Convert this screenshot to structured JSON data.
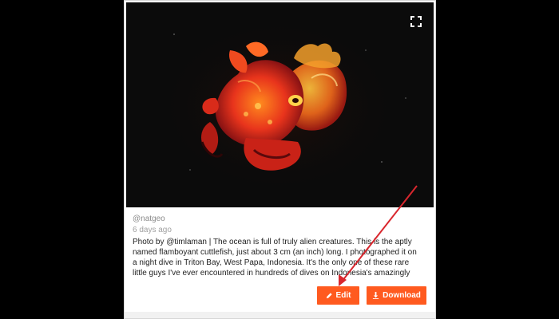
{
  "post": {
    "handle": "@natgeo",
    "age": "6 days ago",
    "caption": "Photo by @timlaman | The ocean is full of truly alien creatures. This is the aptly named flamboyant cuttlefish, just about 3 cm (an inch) long. I photographed it on a night dive in Triton Bay, West Papa, Indonesia. It's the only one of these rare little guys I've ever encountered in hundreds of dives on Indonesia's amazingly diverse coral reefs."
  },
  "actions": {
    "edit_label": "Edit",
    "download_label": "Download"
  },
  "icons": {
    "expand": "expand-icon",
    "edit": "pencil-icon",
    "download": "download-icon"
  },
  "colors": {
    "accent": "#ff5a1f",
    "annotation_arrow": "#d9272e",
    "photo_background": "#0b0b0b"
  }
}
